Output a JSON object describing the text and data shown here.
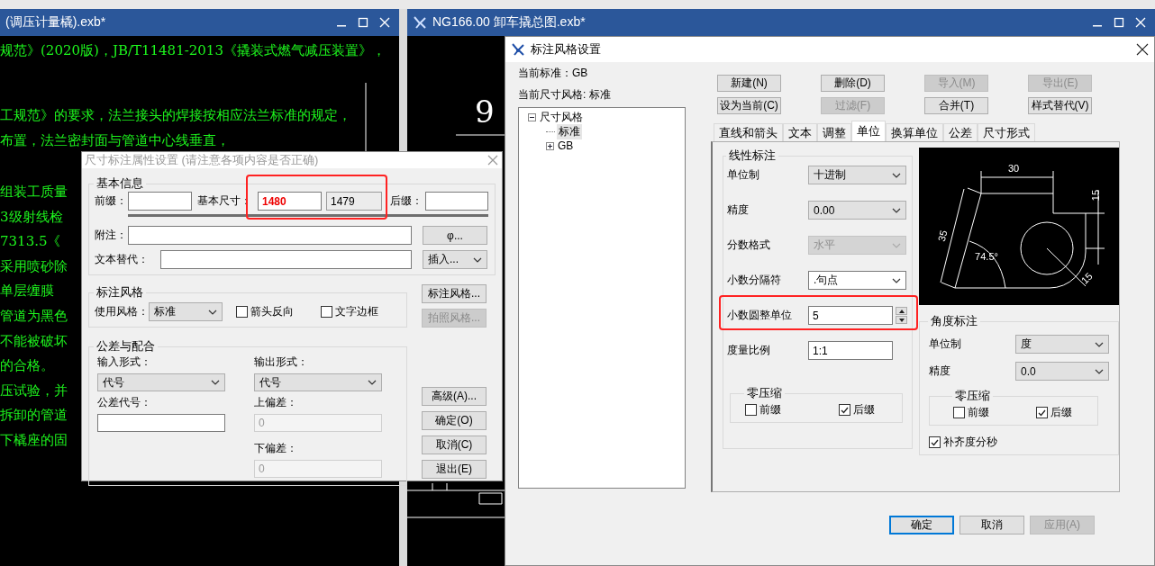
{
  "left_drawing_window": {
    "title": "(调压计量橇).exb*",
    "drawing_lines": [
      "规范》(2020版)，JB/T11481-2013《撬装式燃气减压装置》，",
      "工规范》的要求，法兰接头的焊接按相应法兰标准的规定，",
      "布置，法兰密封面与管道中心线垂直，"
    ],
    "column_lines": [
      "组装工质量",
      "3级射线检",
      "7313.5《",
      "采用喷砂除",
      "单层缠膜",
      "管道为黑色",
      "不能被破坏",
      "的合格。",
      "压试验，并",
      "拆卸的管道",
      "下橇座的固"
    ]
  },
  "right_drawing_window": {
    "title": "NG166.00 卸车撬总图.exb*",
    "drawing_text": "9"
  },
  "dimension_dialog": {
    "title": "尺寸标注属性设置 (请注意各项内容是否正确)",
    "basic_info": {
      "title": "基本信息",
      "prefix_label": "前缀：",
      "basic_size_label": "基本尺寸：",
      "basic_size": "1480",
      "measured_size": "1479",
      "highlighted": true,
      "suffix_label": "后缀：",
      "note_label": "附注：",
      "symbol_button": "φ...",
      "text_override_label": "文本替代：",
      "insert_dropdown": "插入..."
    },
    "style_group": {
      "title": "标注风格",
      "use_style_label": "使用风格：",
      "use_style": "标准",
      "checkboxes": [
        {
          "label": "箭头反向",
          "checked": false
        },
        {
          "label": "文字边框",
          "checked": false
        }
      ]
    },
    "style_buttons": [
      {
        "label": "标注风格...",
        "disabled": false
      },
      {
        "label": "拍照风格...",
        "disabled": true
      }
    ],
    "tolerance_group": {
      "title": "公差与配合",
      "input_form_label": "输入形式：",
      "input_form": "代号",
      "output_form_label": "输出形式：",
      "output_form": "代号",
      "tolerance_code_label": "公差代号：",
      "upper_label": "上偏差：",
      "upper": "0",
      "lower_label": "下偏差：",
      "lower": "0"
    },
    "buttons": [
      "高级(A)...",
      "确定(O)",
      "取消(C)",
      "退出(E)"
    ]
  },
  "style_dialog": {
    "title": "标注风格设置",
    "current_standard": "当前标准：GB",
    "current_style": "当前尺寸风格: 标准",
    "tree": [
      {
        "label": "尺寸风格",
        "expanded": true,
        "selected": false,
        "children": [
          {
            "label": "标准",
            "selected": true
          },
          {
            "label": "GB",
            "expanded": false,
            "selected": false
          }
        ]
      }
    ],
    "actions": [
      {
        "label": "新建(N)",
        "disabled": false
      },
      {
        "label": "删除(D)",
        "disabled": false
      },
      {
        "label": "导入(M)",
        "disabled": true
      },
      {
        "label": "导出(E)",
        "disabled": true
      },
      {
        "label": "设为当前(C)",
        "disabled": false
      },
      {
        "label": "过滤(F)",
        "disabled": true
      },
      {
        "label": "合并(T)",
        "disabled": false
      },
      {
        "label": "样式替代(V)",
        "disabled": false
      }
    ],
    "tabs": [
      {
        "label": "直线和箭头",
        "selected": false
      },
      {
        "label": "文本",
        "selected": false
      },
      {
        "label": "调整",
        "selected": false
      },
      {
        "label": "单位",
        "selected": true
      },
      {
        "label": "换算单位",
        "selected": false
      },
      {
        "label": "公差",
        "selected": false
      },
      {
        "label": "尺寸形式",
        "selected": false
      }
    ],
    "linear": {
      "title": "线性标注",
      "rows": [
        {
          "kind": "select",
          "label": "单位制",
          "value": "十进制",
          "disabled": false,
          "highlighted": false
        },
        {
          "kind": "select",
          "label": "精度",
          "value": "0.00",
          "disabled": false,
          "highlighted": false
        },
        {
          "kind": "select",
          "label": "分数格式",
          "value": "水平",
          "disabled": true,
          "highlighted": false
        },
        {
          "kind": "combo",
          "label": "小数分隔符",
          "value": ".句点",
          "disabled": false,
          "highlighted": false
        },
        {
          "kind": "spin",
          "label": "小数圆整单位",
          "value": "5",
          "disabled": false,
          "highlighted": true
        },
        {
          "kind": "text",
          "label": "度量比例",
          "value": "1:1",
          "disabled": false,
          "highlighted": false
        }
      ],
      "zero_suppression": {
        "title": "零压缩",
        "checkboxes": [
          {
            "label": "前缀",
            "checked": false
          },
          {
            "label": "后缀",
            "checked": true
          }
        ]
      }
    },
    "preview_labels": [
      "30",
      "15",
      "35",
      "74.5°",
      "15"
    ],
    "angular": {
      "title": "角度标注",
      "rows": [
        {
          "kind": "select",
          "label": "单位制",
          "value": "度",
          "disabled": false,
          "highlighted": false
        },
        {
          "kind": "select",
          "label": "精度",
          "value": "0.0",
          "disabled": false,
          "highlighted": false
        }
      ],
      "zero_suppression": {
        "title": "零压缩",
        "checkboxes": [
          {
            "label": "前缀",
            "checked": false
          },
          {
            "label": "后缀",
            "checked": true
          }
        ]
      },
      "fill_checkbox": {
        "label": "补齐度分秒",
        "checked": true
      }
    },
    "footer_buttons": [
      {
        "label": "确定",
        "default": true,
        "disabled": false
      },
      {
        "label": "取消",
        "default": false,
        "disabled": false
      },
      {
        "label": "应用(A)",
        "default": false,
        "disabled": true
      }
    ]
  }
}
